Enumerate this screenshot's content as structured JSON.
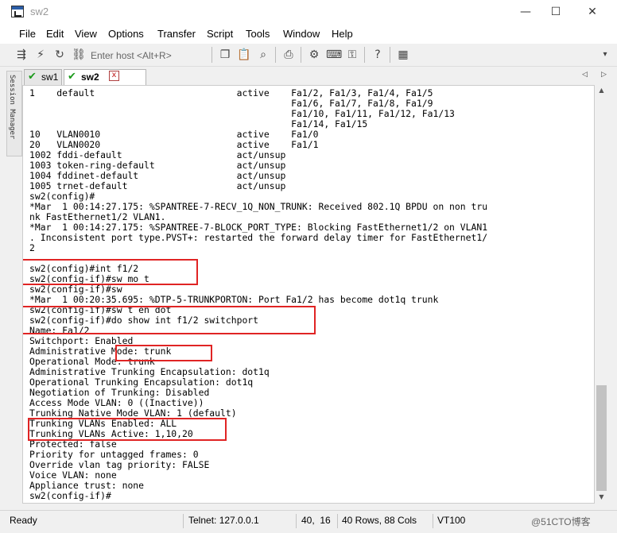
{
  "window": {
    "title": "sw2",
    "minimize": "—",
    "maximize": "☐",
    "close": "✕"
  },
  "menu": [
    "File",
    "Edit",
    "View",
    "Options",
    "Transfer",
    "Script",
    "Tools",
    "Window",
    "Help"
  ],
  "toolbar": {
    "host_placeholder": "Enter host <Alt+R>"
  },
  "session_manager": {
    "label": "Session Manager"
  },
  "tabs": [
    {
      "label": "sw1",
      "active": false
    },
    {
      "label": "sw2",
      "active": true
    }
  ],
  "tab_close": "x",
  "tab_nav": {
    "prev": "◁",
    "next": "▷"
  },
  "terminal": {
    "lines": [
      "1    default                          active    Fa1/2, Fa1/3, Fa1/4, Fa1/5",
      "                                                Fa1/6, Fa1/7, Fa1/8, Fa1/9",
      "                                                Fa1/10, Fa1/11, Fa1/12, Fa1/13",
      "                                                Fa1/14, Fa1/15",
      "10   VLAN0010                         active    Fa1/0",
      "20   VLAN0020                         active    Fa1/1",
      "1002 fddi-default                     act/unsup",
      "1003 token-ring-default               act/unsup",
      "1004 fddinet-default                  act/unsup",
      "1005 trnet-default                    act/unsup",
      "sw2(config)#",
      "*Mar  1 00:14:27.175: %SPANTREE-7-RECV_1Q_NON_TRUNK: Received 802.1Q BPDU on non tru",
      "nk FastEthernet1/2 VLAN1.",
      "*Mar  1 00:14:27.175: %SPANTREE-7-BLOCK_PORT_TYPE: Blocking FastEthernet1/2 on VLAN1",
      ". Inconsistent port type.PVST+: restarted the forward delay timer for FastEthernet1/",
      "2",
      "",
      "sw2(config)#int f1/2",
      "sw2(config-if)#sw mo t",
      "sw2(config-if)#sw",
      "*Mar  1 00:20:35.695: %DTP-5-TRUNKPORTON: Port Fa1/2 has become dot1q trunk",
      "sw2(config-if)#sw t en dot",
      "sw2(config-if)#do show int f1/2 switchport",
      "Name: Fa1/2",
      "Switchport: Enabled",
      "Administrative Mode: trunk",
      "Operational Mode: trunk",
      "Administrative Trunking Encapsulation: dot1q",
      "Operational Trunking Encapsulation: dot1q",
      "Negotiation of Trunking: Disabled",
      "Access Mode VLAN: 0 ((Inactive))",
      "Trunking Native Mode VLAN: 1 (default)",
      "Trunking VLANs Enabled: ALL",
      "Trunking VLANs Active: 1,10,20",
      "Protected: false",
      "Priority for untagged frames: 0",
      "Override vlan tag priority: FALSE",
      "Voice VLAN: none",
      "Appliance trust: none",
      "sw2(config-if)#"
    ]
  },
  "status": {
    "ready": "Ready",
    "connection": "Telnet: 127.0.0.1",
    "cursor": "40,  16",
    "size": "40 Rows, 88 Cols",
    "emulation": "VT100",
    "watermark": "@51CTO博客"
  },
  "colors": {
    "highlight": "#e02424",
    "tab_check": "#1c9a1c"
  }
}
